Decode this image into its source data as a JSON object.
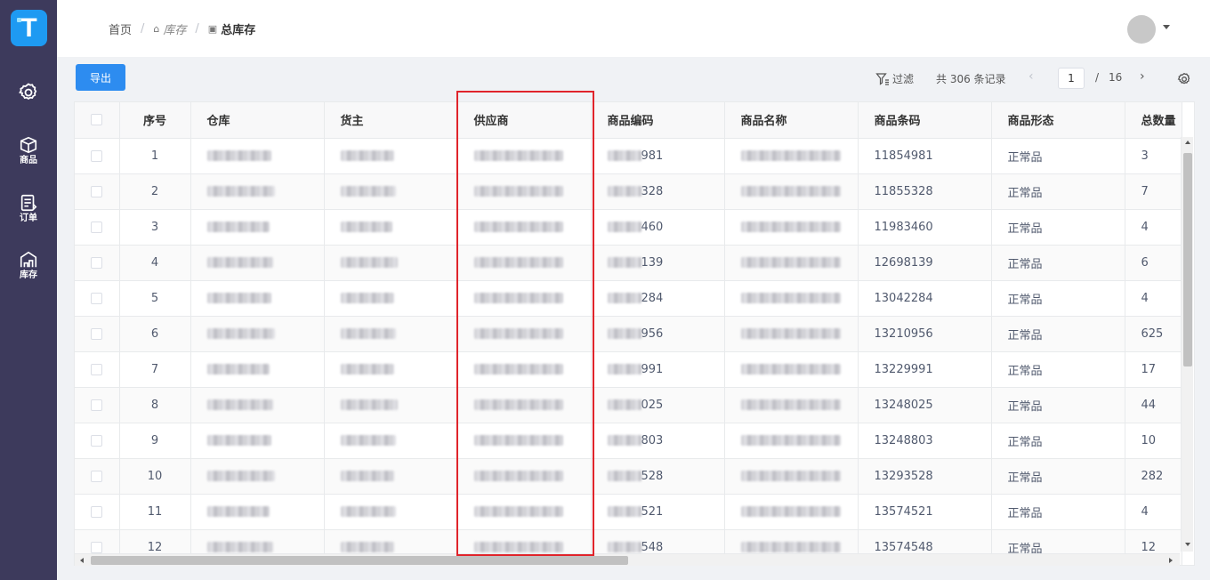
{
  "app": {
    "logo_letter": "T",
    "accent": "#2d8cf0",
    "sidebar_bg": "#3d3a5c",
    "highlight_color": "#e0242b"
  },
  "sidebar": {
    "items": [
      {
        "icon": "gear-icon",
        "label": ""
      },
      {
        "icon": "box-icon",
        "label": "商品"
      },
      {
        "icon": "order-icon",
        "label": "订单"
      },
      {
        "icon": "warehouse-icon",
        "label": "库存"
      }
    ]
  },
  "breadcrumb": {
    "home": "首页",
    "inventory": "库存",
    "current": "总库存"
  },
  "toolbar": {
    "export_label": "导出",
    "filter_label": "过滤",
    "record_count": "共 306 条记录",
    "current_page": "1",
    "page_sep": "/",
    "total_pages": "16"
  },
  "table": {
    "columns": [
      "序号",
      "仓库",
      "货主",
      "供应商",
      "商品编码",
      "商品名称",
      "商品条码",
      "商品形态",
      "总数量"
    ],
    "rows": [
      {
        "seq": "1",
        "code_tail": "981",
        "barcode": "11854981",
        "form": "正常品",
        "qty": "3"
      },
      {
        "seq": "2",
        "code_tail": "328",
        "barcode": "11855328",
        "form": "正常品",
        "qty": "7"
      },
      {
        "seq": "3",
        "code_tail": "460",
        "barcode": "11983460",
        "form": "正常品",
        "qty": "4"
      },
      {
        "seq": "4",
        "code_tail": "139",
        "barcode": "12698139",
        "form": "正常品",
        "qty": "6"
      },
      {
        "seq": "5",
        "code_tail": "284",
        "barcode": "13042284",
        "form": "正常品",
        "qty": "4"
      },
      {
        "seq": "6",
        "code_tail": "956",
        "barcode": "13210956",
        "form": "正常品",
        "qty": "625"
      },
      {
        "seq": "7",
        "code_tail": "991",
        "barcode": "13229991",
        "form": "正常品",
        "qty": "17"
      },
      {
        "seq": "8",
        "code_tail": "025",
        "barcode": "13248025",
        "form": "正常品",
        "qty": "44"
      },
      {
        "seq": "9",
        "code_tail": "803",
        "barcode": "13248803",
        "form": "正常品",
        "qty": "10"
      },
      {
        "seq": "10",
        "code_tail": "528",
        "barcode": "13293528",
        "form": "正常品",
        "qty": "282"
      },
      {
        "seq": "11",
        "code_tail": "521",
        "barcode": "13574521",
        "form": "正常品",
        "qty": "4"
      },
      {
        "seq": "12",
        "code_tail": "548",
        "barcode": "13574548",
        "form": "正常品",
        "qty": "12"
      }
    ]
  }
}
